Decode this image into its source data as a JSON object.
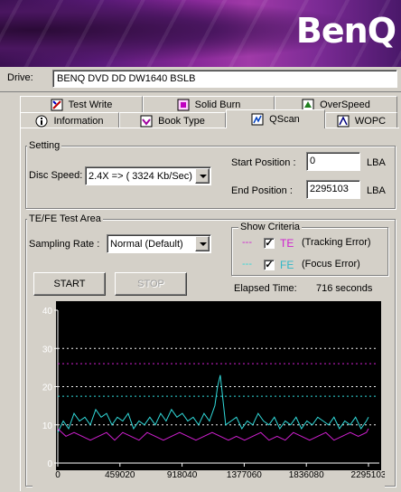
{
  "banner": {
    "brand": "BenQ"
  },
  "drive": {
    "label": "Drive:",
    "value": "BENQ    DVD DD DW1640    BSLB"
  },
  "tabs_row1": [
    {
      "label": "Test Write",
      "icon": "test-write-icon"
    },
    {
      "label": "Solid Burn",
      "icon": "solid-burn-icon"
    },
    {
      "label": "OverSpeed",
      "icon": "overspeed-icon"
    }
  ],
  "tabs_row2": [
    {
      "label": "Information",
      "icon": "info-icon"
    },
    {
      "label": "Book Type",
      "icon": "book-type-icon"
    },
    {
      "label": "QScan",
      "icon": "qscan-icon",
      "selected": true
    },
    {
      "label": "WOPC",
      "icon": "wopc-icon"
    }
  ],
  "setting": {
    "title": "Setting",
    "disc_speed_label": "Disc Speed:",
    "disc_speed_value": "2.4X => ( 3324 Kb/Sec)",
    "start_label": "Start Position :",
    "start_value": "0",
    "start_unit": "LBA",
    "end_label": "End Position :",
    "end_value": "2295103",
    "end_unit": "LBA"
  },
  "test_area": {
    "title": "TE/FE Test Area",
    "sampling_label": "Sampling Rate :",
    "sampling_value": "Normal (Default)",
    "show_criteria": {
      "title": "Show Criteria",
      "te": {
        "dash": "---",
        "code": "TE",
        "desc": "(Tracking Error)",
        "checked": true,
        "color": "#d020d0"
      },
      "fe": {
        "dash": "---",
        "code": "FE",
        "desc": "(Focus Error)",
        "checked": true,
        "color": "#30d8d8"
      }
    },
    "start_button": "START",
    "stop_button": "STOP",
    "elapsed_label": "Elapsed Time:",
    "elapsed_value": "716 seconds"
  },
  "chart_data": {
    "type": "line",
    "x_ticks": [
      "0",
      "459020",
      "918040",
      "1377060",
      "1836080",
      "2295103"
    ],
    "y_ticks": [
      "0",
      "10",
      "20",
      "30",
      "40"
    ],
    "xlim": [
      0,
      2295103
    ],
    "ylim": [
      0,
      40
    ],
    "background": "#000000",
    "thresholds": [
      {
        "series": "TE",
        "value": 26,
        "color": "#d020d0"
      },
      {
        "series": "FE",
        "value": 17.5,
        "color": "#30d8d8"
      },
      {
        "value": 30,
        "color": "#f0f0f0"
      },
      {
        "value": 20,
        "color": "#f0f0f0"
      },
      {
        "value": 10,
        "color": "#f0f0f0"
      }
    ],
    "series": [
      {
        "code": "FE",
        "color": "#30d8d8",
        "x": [
          0,
          40000,
          80000,
          120000,
          160000,
          200000,
          240000,
          280000,
          320000,
          360000,
          400000,
          440000,
          480000,
          520000,
          560000,
          600000,
          640000,
          680000,
          720000,
          760000,
          800000,
          840000,
          880000,
          920000,
          960000,
          1000000,
          1040000,
          1080000,
          1120000,
          1160000,
          1180000,
          1200000,
          1240000,
          1280000,
          1320000,
          1360000,
          1400000,
          1440000,
          1480000,
          1520000,
          1560000,
          1600000,
          1640000,
          1680000,
          1720000,
          1760000,
          1800000,
          1840000,
          1880000,
          1920000,
          1960000,
          2000000,
          2040000,
          2080000,
          2120000,
          2160000,
          2200000,
          2240000,
          2280000,
          2295103
        ],
        "values": [
          8,
          11,
          9,
          13,
          11,
          12,
          10,
          14,
          12,
          13,
          10,
          12,
          11,
          13,
          9,
          11,
          10,
          12,
          10,
          13,
          11,
          14,
          12,
          13,
          11,
          12,
          10,
          13,
          11,
          15,
          20,
          23,
          10,
          11,
          12,
          9,
          11,
          10,
          13,
          11,
          10,
          12,
          9,
          11,
          10,
          12,
          9,
          11,
          10,
          12,
          11,
          10,
          12,
          9,
          11,
          10,
          12,
          9,
          11,
          12
        ]
      },
      {
        "code": "TE",
        "color": "#d020d0",
        "x": [
          0,
          60000,
          120000,
          180000,
          240000,
          300000,
          360000,
          420000,
          480000,
          540000,
          600000,
          660000,
          720000,
          780000,
          840000,
          900000,
          960000,
          1020000,
          1080000,
          1140000,
          1200000,
          1260000,
          1320000,
          1380000,
          1440000,
          1500000,
          1560000,
          1620000,
          1680000,
          1740000,
          1800000,
          1860000,
          1920000,
          1980000,
          2040000,
          2100000,
          2160000,
          2220000,
          2280000,
          2295103
        ],
        "values": [
          9,
          7,
          8,
          7,
          6,
          7,
          8,
          6,
          8,
          7,
          6,
          8,
          7,
          6,
          7,
          8,
          7,
          6,
          7,
          8,
          7,
          6,
          7,
          6,
          7,
          8,
          6,
          7,
          6,
          8,
          7,
          6,
          7,
          8,
          6,
          7,
          8,
          7,
          8,
          9
        ]
      }
    ]
  }
}
